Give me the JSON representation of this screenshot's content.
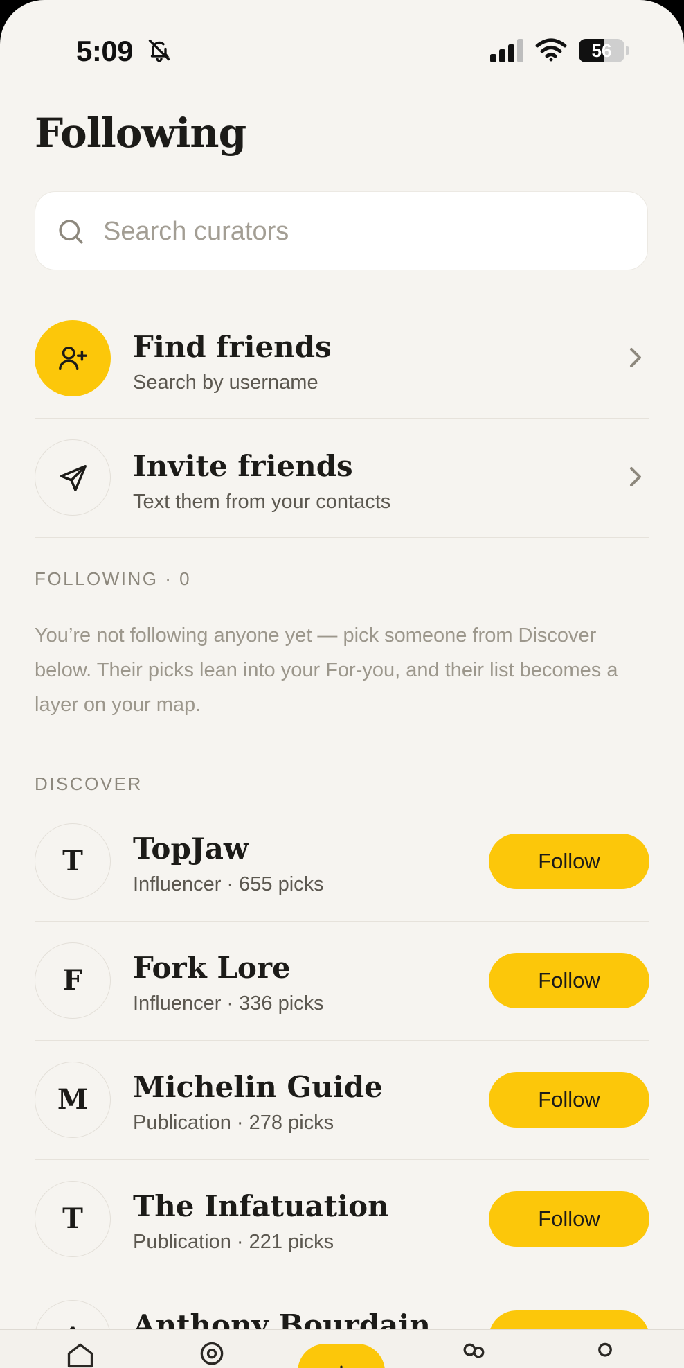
{
  "status_bar": {
    "time": "5:09",
    "battery": "56",
    "battery_level": 0.56
  },
  "header": {
    "title": "Following"
  },
  "search": {
    "placeholder": "Search curators",
    "value": ""
  },
  "actions": [
    {
      "title": "Find friends",
      "subtitle": "Search by username",
      "icon": "user-plus-icon"
    },
    {
      "title": "Invite friends",
      "subtitle": "Text them from your contacts",
      "icon": "send-icon"
    }
  ],
  "following_section": {
    "label": "FOLLOWING · 0",
    "empty_text": "You’re not following anyone yet — pick someone from Discover below. Their picks lean into your For-you, and their list becomes a layer on your map."
  },
  "discover_section": {
    "label": "DISCOVER",
    "curators": [
      {
        "initial": "T",
        "name": "TopJaw",
        "meta": "Influencer · 655 picks",
        "button": "Follow"
      },
      {
        "initial": "F",
        "name": "Fork Lore",
        "meta": "Influencer · 336 picks",
        "button": "Follow"
      },
      {
        "initial": "M",
        "name": "Michelin Guide",
        "meta": "Publication · 278 picks",
        "button": "Follow"
      },
      {
        "initial": "T",
        "name": "The Infatuation",
        "meta": "Publication · 221 picks",
        "button": "Follow"
      },
      {
        "initial": "A",
        "name": "Anthony Bourdain",
        "meta": "",
        "button": "Follow"
      }
    ]
  },
  "tab_bar": {
    "tabs": [
      "home-icon",
      "map-pin-icon",
      "add-icon",
      "people-icon",
      "profile-icon"
    ]
  },
  "colors": {
    "accent": "#fcc70a",
    "background": "#f6f4f0",
    "text": "#1c1b18",
    "muted": "#9c978c"
  }
}
